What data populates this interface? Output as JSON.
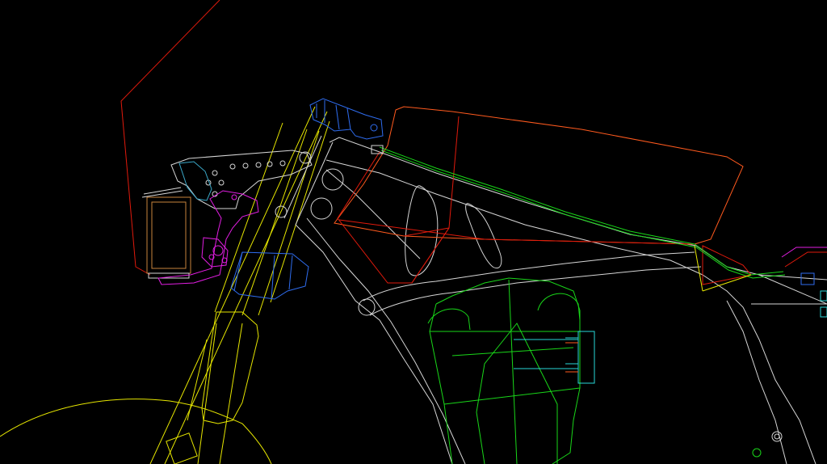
{
  "drawing": {
    "background": "#000000",
    "layers": [
      {
        "name": "frame",
        "color": "#d6d6d6"
      },
      {
        "name": "fork",
        "color": "#e6e600"
      },
      {
        "name": "fairing",
        "color": "#e11a0c"
      },
      {
        "name": "tank",
        "color": "#ff5a1e"
      },
      {
        "name": "seat-rail",
        "color": "#19d619"
      },
      {
        "name": "battery-box",
        "color": "#19d619"
      },
      {
        "name": "triple-clamp",
        "color": "#2f6df0"
      },
      {
        "name": "connectors",
        "color": "#29d8d8"
      },
      {
        "name": "headlight-bracket",
        "color": "#e21ee2"
      },
      {
        "name": "headlight",
        "color": "#c8843c"
      }
    ]
  }
}
